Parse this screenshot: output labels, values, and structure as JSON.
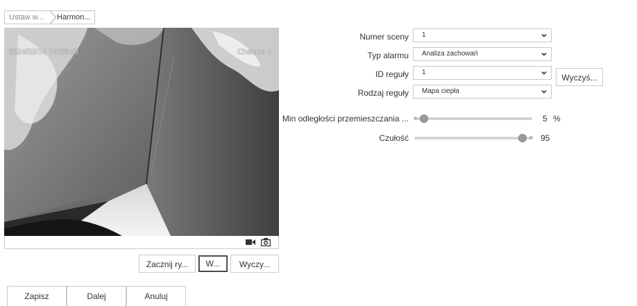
{
  "tabs": [
    {
      "label": "Ustaw w...",
      "active": false
    },
    {
      "label": "Harmon...",
      "active": true
    }
  ],
  "video": {
    "timestamp": "2024/02/14 10:06:43",
    "channel": "Channel 1",
    "record_icon": "video-camera-icon",
    "snapshot_icon": "camera-icon"
  },
  "draw_buttons": {
    "start": "Zacznij ry...",
    "stop": "W...",
    "clear": "Wyczy..."
  },
  "form": {
    "scene": {
      "label": "Numer sceny",
      "value": "1"
    },
    "alarm_type": {
      "label": "Typ alarmu",
      "value": "Analiza zachowań"
    },
    "rule_id": {
      "label": "ID reguły",
      "value": "1",
      "clear_button": "Wyczyś..."
    },
    "rule_kind": {
      "label": "Rodzaj reguły",
      "value": "Mapa ciepła"
    },
    "min_distance": {
      "label": "Min odległości przemieszczania ...",
      "value": "5",
      "unit": "%",
      "fraction": 0.05
    },
    "sensitivity": {
      "label": "Czułość",
      "value": "95",
      "fraction": 0.95
    }
  },
  "footer": {
    "save": "Zapisz",
    "next": "Dalej",
    "cancel": "Anuluj"
  }
}
